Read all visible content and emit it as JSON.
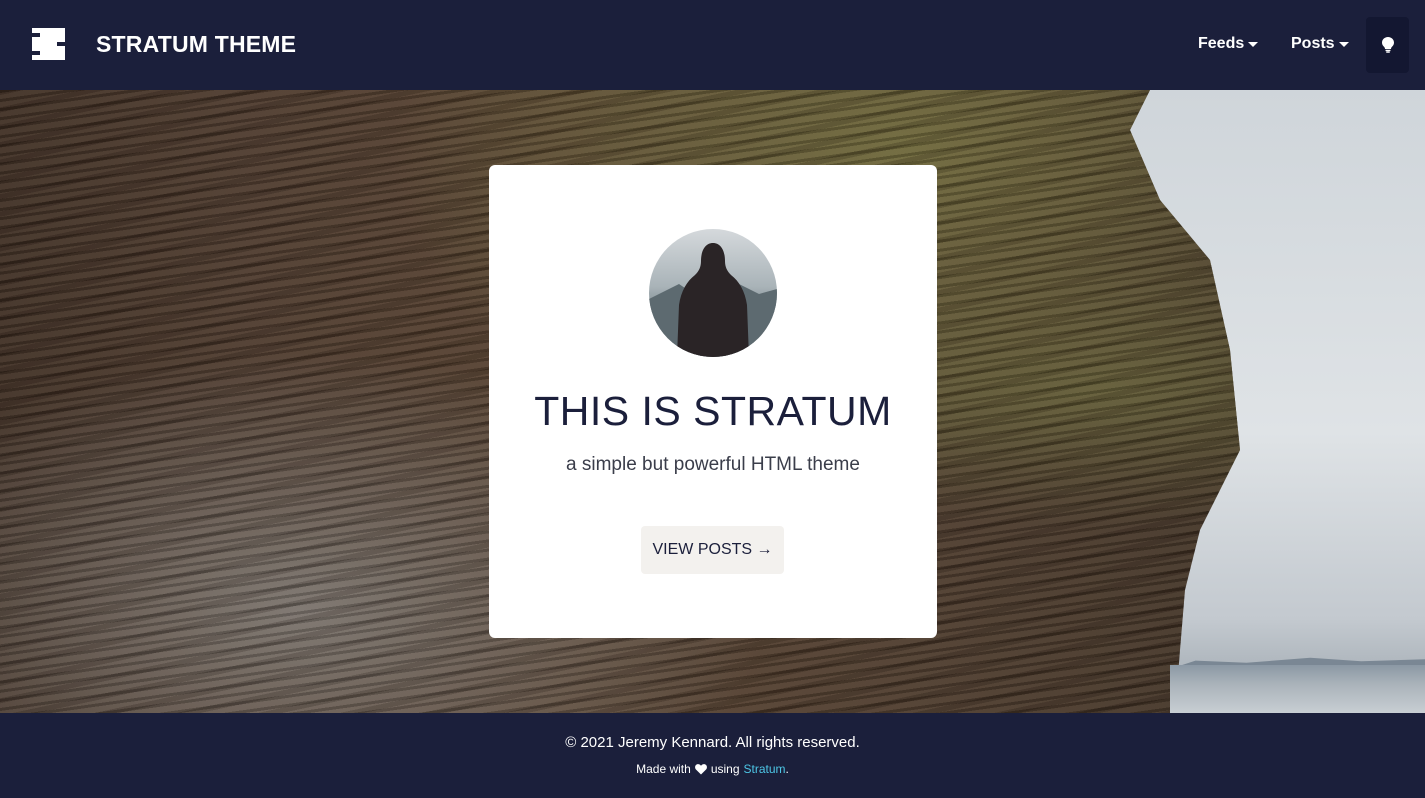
{
  "header": {
    "brand": "STRATUM THEME",
    "nav": [
      {
        "label": "Feeds"
      },
      {
        "label": "Posts"
      }
    ],
    "theme_toggle_icon": "lightbulb-icon"
  },
  "hero": {
    "title": "THIS IS STRATUM",
    "subtitle": "a simple but powerful HTML theme",
    "button_label": "VIEW POSTS →"
  },
  "footer": {
    "copyright": "© 2021 Jeremy Kennard. All rights reserved.",
    "made_with_prefix": "Made with",
    "made_with_middle": "using",
    "made_with_link": "Stratum",
    "made_with_suffix": ".",
    "link_color": "#4dc6e6"
  },
  "colors": {
    "navy": "#1b1f3b",
    "card": "#ffffff",
    "button_bg": "#f3f1ee"
  }
}
